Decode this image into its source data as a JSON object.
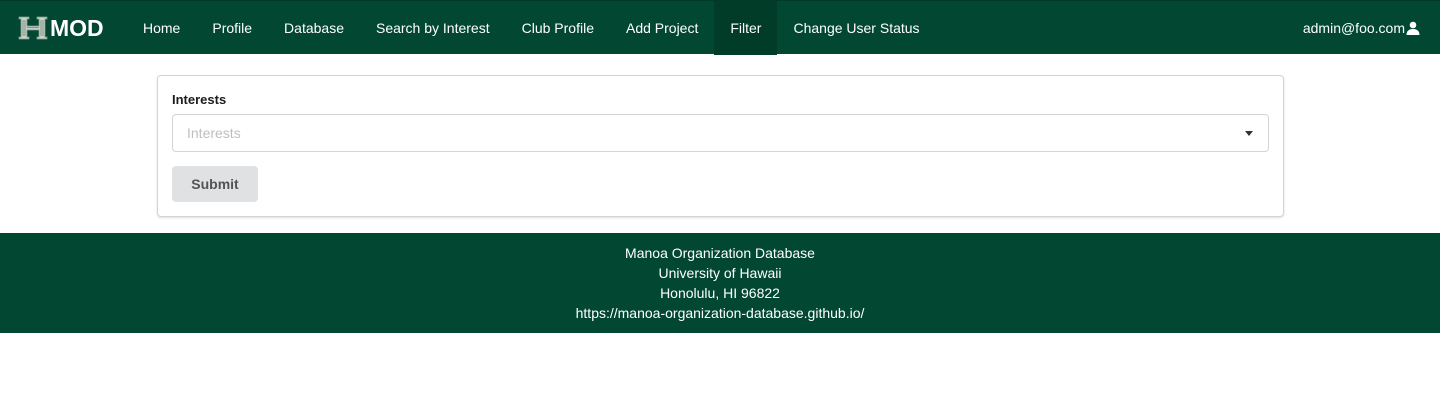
{
  "navbar": {
    "brand_text": "MOD",
    "brand_logo_icon": "uh-h-logo-icon",
    "background_color": "#024731",
    "items": [
      {
        "label": "Home"
      },
      {
        "label": "Profile"
      },
      {
        "label": "Database"
      },
      {
        "label": "Search by Interest"
      },
      {
        "label": "Club Profile"
      },
      {
        "label": "Add Project"
      },
      {
        "label": "Filter",
        "active": true
      },
      {
        "label": "Change User Status"
      }
    ],
    "user": {
      "email": "admin@foo.com",
      "icon": "user-icon"
    }
  },
  "form": {
    "interests_label": "Interests",
    "interests_placeholder": "Interests",
    "dropdown_icon": "caret-down-icon",
    "submit_label": "Submit"
  },
  "footer": {
    "line1": "Manoa Organization Database",
    "line2": "University of Hawaii",
    "line3": "Honolulu, HI 96822",
    "line4": "https://manoa-organization-database.github.io/"
  }
}
